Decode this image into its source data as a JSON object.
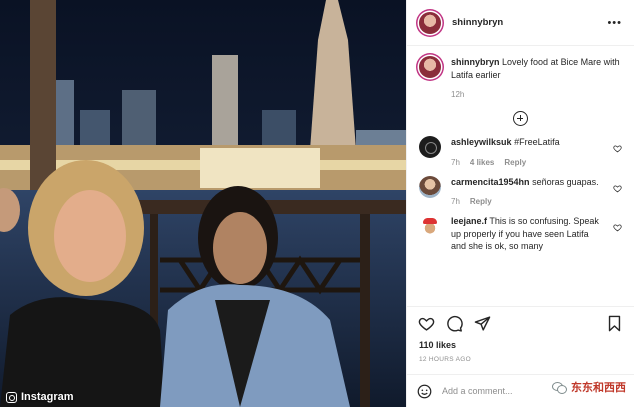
{
  "post": {
    "watermark": "Instagram",
    "author": "shinnybryn",
    "caption": {
      "username": "shinnybryn",
      "text": "Lovely food at Bice Mare with Latifa earlier",
      "time": "12h"
    },
    "comments": [
      {
        "username": "ashleywilksuk",
        "text": "#FreeLatifa",
        "time": "7h",
        "likes": "4 likes",
        "reply": "Reply"
      },
      {
        "username": "carmencita1954hn",
        "text": "señoras guapas.",
        "time": "7h",
        "likes": "",
        "reply": "Reply"
      },
      {
        "username": "leejane.f",
        "text": "This is so confusing. Speak up properly if you have seen Latifa and she is ok, so many",
        "time": "",
        "likes": "",
        "reply": ""
      }
    ],
    "likes_count": "110 likes",
    "posted_ago": "12 HOURS AGO",
    "add_comment_placeholder": "Add a comment...",
    "overlay_watermark": "东东和西西"
  },
  "icons": {
    "more": "more-horizontal-icon",
    "heart": "heart-icon",
    "comment": "comment-icon",
    "share": "share-icon",
    "bookmark": "bookmark-icon",
    "emoji": "emoji-icon",
    "load_more": "plus-circle-icon"
  }
}
